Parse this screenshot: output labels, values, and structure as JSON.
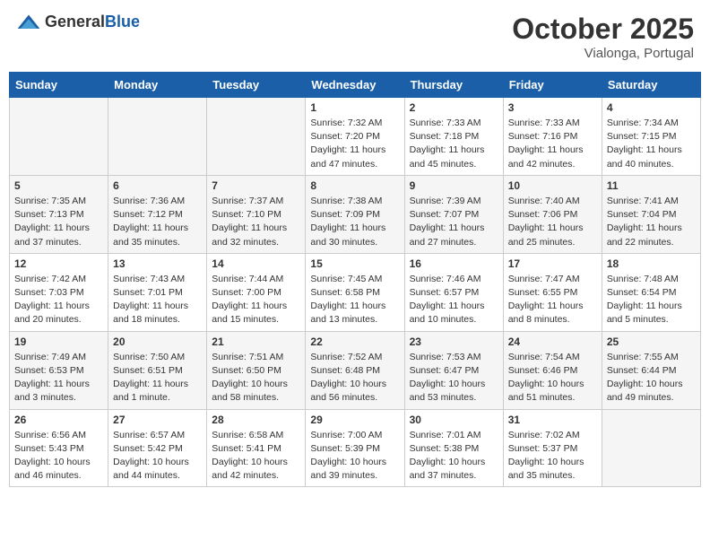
{
  "header": {
    "logo_general": "General",
    "logo_blue": "Blue",
    "month": "October 2025",
    "location": "Vialonga, Portugal"
  },
  "weekdays": [
    "Sunday",
    "Monday",
    "Tuesday",
    "Wednesday",
    "Thursday",
    "Friday",
    "Saturday"
  ],
  "weeks": [
    [
      {
        "day": "",
        "sunrise": "",
        "sunset": "",
        "daylight": ""
      },
      {
        "day": "",
        "sunrise": "",
        "sunset": "",
        "daylight": ""
      },
      {
        "day": "",
        "sunrise": "",
        "sunset": "",
        "daylight": ""
      },
      {
        "day": "1",
        "sunrise": "Sunrise: 7:32 AM",
        "sunset": "Sunset: 7:20 PM",
        "daylight": "Daylight: 11 hours and 47 minutes."
      },
      {
        "day": "2",
        "sunrise": "Sunrise: 7:33 AM",
        "sunset": "Sunset: 7:18 PM",
        "daylight": "Daylight: 11 hours and 45 minutes."
      },
      {
        "day": "3",
        "sunrise": "Sunrise: 7:33 AM",
        "sunset": "Sunset: 7:16 PM",
        "daylight": "Daylight: 11 hours and 42 minutes."
      },
      {
        "day": "4",
        "sunrise": "Sunrise: 7:34 AM",
        "sunset": "Sunset: 7:15 PM",
        "daylight": "Daylight: 11 hours and 40 minutes."
      }
    ],
    [
      {
        "day": "5",
        "sunrise": "Sunrise: 7:35 AM",
        "sunset": "Sunset: 7:13 PM",
        "daylight": "Daylight: 11 hours and 37 minutes."
      },
      {
        "day": "6",
        "sunrise": "Sunrise: 7:36 AM",
        "sunset": "Sunset: 7:12 PM",
        "daylight": "Daylight: 11 hours and 35 minutes."
      },
      {
        "day": "7",
        "sunrise": "Sunrise: 7:37 AM",
        "sunset": "Sunset: 7:10 PM",
        "daylight": "Daylight: 11 hours and 32 minutes."
      },
      {
        "day": "8",
        "sunrise": "Sunrise: 7:38 AM",
        "sunset": "Sunset: 7:09 PM",
        "daylight": "Daylight: 11 hours and 30 minutes."
      },
      {
        "day": "9",
        "sunrise": "Sunrise: 7:39 AM",
        "sunset": "Sunset: 7:07 PM",
        "daylight": "Daylight: 11 hours and 27 minutes."
      },
      {
        "day": "10",
        "sunrise": "Sunrise: 7:40 AM",
        "sunset": "Sunset: 7:06 PM",
        "daylight": "Daylight: 11 hours and 25 minutes."
      },
      {
        "day": "11",
        "sunrise": "Sunrise: 7:41 AM",
        "sunset": "Sunset: 7:04 PM",
        "daylight": "Daylight: 11 hours and 22 minutes."
      }
    ],
    [
      {
        "day": "12",
        "sunrise": "Sunrise: 7:42 AM",
        "sunset": "Sunset: 7:03 PM",
        "daylight": "Daylight: 11 hours and 20 minutes."
      },
      {
        "day": "13",
        "sunrise": "Sunrise: 7:43 AM",
        "sunset": "Sunset: 7:01 PM",
        "daylight": "Daylight: 11 hours and 18 minutes."
      },
      {
        "day": "14",
        "sunrise": "Sunrise: 7:44 AM",
        "sunset": "Sunset: 7:00 PM",
        "daylight": "Daylight: 11 hours and 15 minutes."
      },
      {
        "day": "15",
        "sunrise": "Sunrise: 7:45 AM",
        "sunset": "Sunset: 6:58 PM",
        "daylight": "Daylight: 11 hours and 13 minutes."
      },
      {
        "day": "16",
        "sunrise": "Sunrise: 7:46 AM",
        "sunset": "Sunset: 6:57 PM",
        "daylight": "Daylight: 11 hours and 10 minutes."
      },
      {
        "day": "17",
        "sunrise": "Sunrise: 7:47 AM",
        "sunset": "Sunset: 6:55 PM",
        "daylight": "Daylight: 11 hours and 8 minutes."
      },
      {
        "day": "18",
        "sunrise": "Sunrise: 7:48 AM",
        "sunset": "Sunset: 6:54 PM",
        "daylight": "Daylight: 11 hours and 5 minutes."
      }
    ],
    [
      {
        "day": "19",
        "sunrise": "Sunrise: 7:49 AM",
        "sunset": "Sunset: 6:53 PM",
        "daylight": "Daylight: 11 hours and 3 minutes."
      },
      {
        "day": "20",
        "sunrise": "Sunrise: 7:50 AM",
        "sunset": "Sunset: 6:51 PM",
        "daylight": "Daylight: 11 hours and 1 minute."
      },
      {
        "day": "21",
        "sunrise": "Sunrise: 7:51 AM",
        "sunset": "Sunset: 6:50 PM",
        "daylight": "Daylight: 10 hours and 58 minutes."
      },
      {
        "day": "22",
        "sunrise": "Sunrise: 7:52 AM",
        "sunset": "Sunset: 6:48 PM",
        "daylight": "Daylight: 10 hours and 56 minutes."
      },
      {
        "day": "23",
        "sunrise": "Sunrise: 7:53 AM",
        "sunset": "Sunset: 6:47 PM",
        "daylight": "Daylight: 10 hours and 53 minutes."
      },
      {
        "day": "24",
        "sunrise": "Sunrise: 7:54 AM",
        "sunset": "Sunset: 6:46 PM",
        "daylight": "Daylight: 10 hours and 51 minutes."
      },
      {
        "day": "25",
        "sunrise": "Sunrise: 7:55 AM",
        "sunset": "Sunset: 6:44 PM",
        "daylight": "Daylight: 10 hours and 49 minutes."
      }
    ],
    [
      {
        "day": "26",
        "sunrise": "Sunrise: 6:56 AM",
        "sunset": "Sunset: 5:43 PM",
        "daylight": "Daylight: 10 hours and 46 minutes."
      },
      {
        "day": "27",
        "sunrise": "Sunrise: 6:57 AM",
        "sunset": "Sunset: 5:42 PM",
        "daylight": "Daylight: 10 hours and 44 minutes."
      },
      {
        "day": "28",
        "sunrise": "Sunrise: 6:58 AM",
        "sunset": "Sunset: 5:41 PM",
        "daylight": "Daylight: 10 hours and 42 minutes."
      },
      {
        "day": "29",
        "sunrise": "Sunrise: 7:00 AM",
        "sunset": "Sunset: 5:39 PM",
        "daylight": "Daylight: 10 hours and 39 minutes."
      },
      {
        "day": "30",
        "sunrise": "Sunrise: 7:01 AM",
        "sunset": "Sunset: 5:38 PM",
        "daylight": "Daylight: 10 hours and 37 minutes."
      },
      {
        "day": "31",
        "sunrise": "Sunrise: 7:02 AM",
        "sunset": "Sunset: 5:37 PM",
        "daylight": "Daylight: 10 hours and 35 minutes."
      },
      {
        "day": "",
        "sunrise": "",
        "sunset": "",
        "daylight": ""
      }
    ]
  ]
}
